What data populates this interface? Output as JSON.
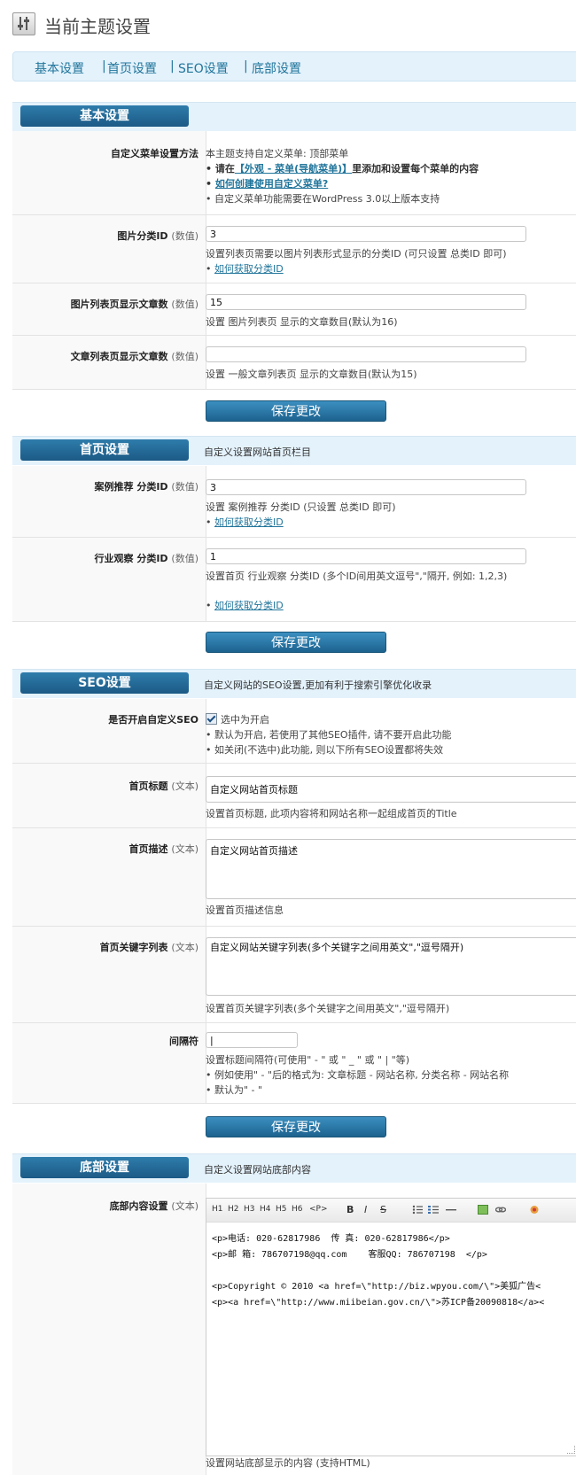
{
  "header": {
    "title": "当前主题设置"
  },
  "nav": {
    "items": [
      "基本设置",
      "首页设置",
      "SEO设置",
      "底部设置"
    ],
    "separator": "|"
  },
  "sections": {
    "basic": {
      "tab": "基本设置",
      "desc": ""
    },
    "home": {
      "tab": "首页设置",
      "desc": "自定义设置网站首页栏目"
    },
    "seo": {
      "tab": "SEO设置",
      "desc": "自定义网站的SEO设置,更加有利于搜索引擎优化收录"
    },
    "footer": {
      "tab": "底部设置",
      "desc": "自定义设置网站底部内容"
    }
  },
  "basic": {
    "menu": {
      "label": "自定义菜单设置方法",
      "line1": "本主题支持自定义菜单: 顶部菜单",
      "line2_pre": "• 请在",
      "line2_link": "【外观 - 菜单(导航菜单)】",
      "line2_post": "里添加和设置每个菜单的内容",
      "line3": "如何创建使用自定义菜单?",
      "line4": "• 自定义菜单功能需要在WordPress 3.0以上版本支持"
    },
    "pic_cat": {
      "label": "图片分类ID",
      "unit": "(数值)",
      "value": "3",
      "help": "设置列表页需要以图片列表形式显示的分类ID (可只设置 总类ID 即可)",
      "link": "如何获取分类ID"
    },
    "pic_count": {
      "label": "图片列表页显示文章数",
      "unit": "(数值)",
      "value": "15",
      "help": "设置 图片列表页 显示的文章数目(默认为16)"
    },
    "post_count": {
      "label": "文章列表页显示文章数",
      "unit": "(数值)",
      "value": "",
      "help": "设置 一般文章列表页 显示的文章数目(默认为15)"
    }
  },
  "home": {
    "case": {
      "label": "案例推荐 分类ID",
      "unit": "(数值)",
      "value": "3",
      "help": "设置 案例推荐 分类ID (只设置 总类ID 即可)",
      "link": "如何获取分类ID"
    },
    "industry": {
      "label": "行业观察 分类ID",
      "unit": "(数值)",
      "value": "1",
      "help": "设置首页 行业观察 分类ID (多个ID间用英文逗号\",\"隔开, 例如: 1,2,3)",
      "link": "如何获取分类ID"
    }
  },
  "seo": {
    "enable": {
      "label": "是否开启自定义SEO",
      "checkbox_label": "选中为开启",
      "checked": true,
      "note1": "• 默认为开启, 若使用了其他SEO插件, 请不要开启此功能",
      "note2": "• 如关闭(不选中)此功能, 则以下所有SEO设置都将失效"
    },
    "title": {
      "label": "首页标题",
      "unit": "(文本)",
      "value": "自定义网站首页标题",
      "help": "设置首页标题, 此项内容将和网站名称一起组成首页的Title"
    },
    "description": {
      "label": "首页描述",
      "unit": "(文本)",
      "value": "自定义网站首页描述",
      "help": "设置首页描述信息"
    },
    "keywords": {
      "label": "首页关键字列表",
      "unit": "(文本)",
      "value": "自定义网站关键字列表(多个关键字之间用英文\",\"逗号隔开)",
      "help": "设置首页关键字列表(多个关键字之间用英文\",\"逗号隔开)"
    },
    "separator": {
      "label": "间隔符",
      "value": "|",
      "help": "设置标题间隔符(可使用\" - \" 或 \" _ \" 或 \" | \"等)",
      "note1": "• 例如使用\" - \"后的格式为: 文章标题 - 网站名称, 分类名称 - 网站名称",
      "note2": "• 默认为\" - \""
    }
  },
  "footer": {
    "content": {
      "label": "底部内容设置",
      "unit": "(文本)",
      "toolbar": [
        "H1",
        "H2",
        "H3",
        "H4",
        "H5",
        "H6",
        "<P>",
        "B",
        "I",
        "S"
      ],
      "lines": [
        "<p>电话: 020-62817986  传 真: 020-62817986</p>",
        "<p>邮 箱: 786707198@qq.com    客服QQ: 786707198  </p>",
        "",
        "<p>Copyright © 2010 <a href=\\\"http://biz.wpyou.com/\\\">美狐广告<",
        "<p><a href=\\\"http://www.miibeian.gov.cn/\\\">苏ICP备20090818</a><"
      ],
      "help": "设置网站底部显示的内容 (支持HTML)"
    }
  },
  "buttons": {
    "save": "保存更改"
  }
}
